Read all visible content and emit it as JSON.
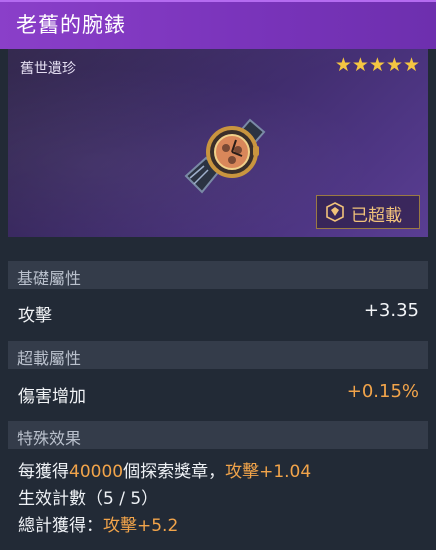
{
  "item": {
    "name": "老舊的腕錶",
    "category": "舊世遺珍",
    "stars": "★★★★★",
    "status": "已超載"
  },
  "sections": {
    "base": {
      "title": "基礎屬性",
      "stat_name": "攻擊",
      "stat_value": "+3.35"
    },
    "overload": {
      "title": "超載屬性",
      "stat_name": "傷害增加",
      "stat_value": "+0.15%"
    },
    "special": {
      "title": "特殊效果",
      "line1_pre": "每獲得",
      "line1_num": "40000",
      "line1_mid": "個探索獎章，",
      "line1_effect": "攻擊+1.04",
      "line2": "生效計數（5 / 5）",
      "line3_pre": "總計獲得：",
      "line3_effect": "攻擊+5.2"
    }
  },
  "colors": {
    "title_bar": "#8a3fc9",
    "accent_orange": "#f2a44a",
    "star": "#f4c542"
  }
}
